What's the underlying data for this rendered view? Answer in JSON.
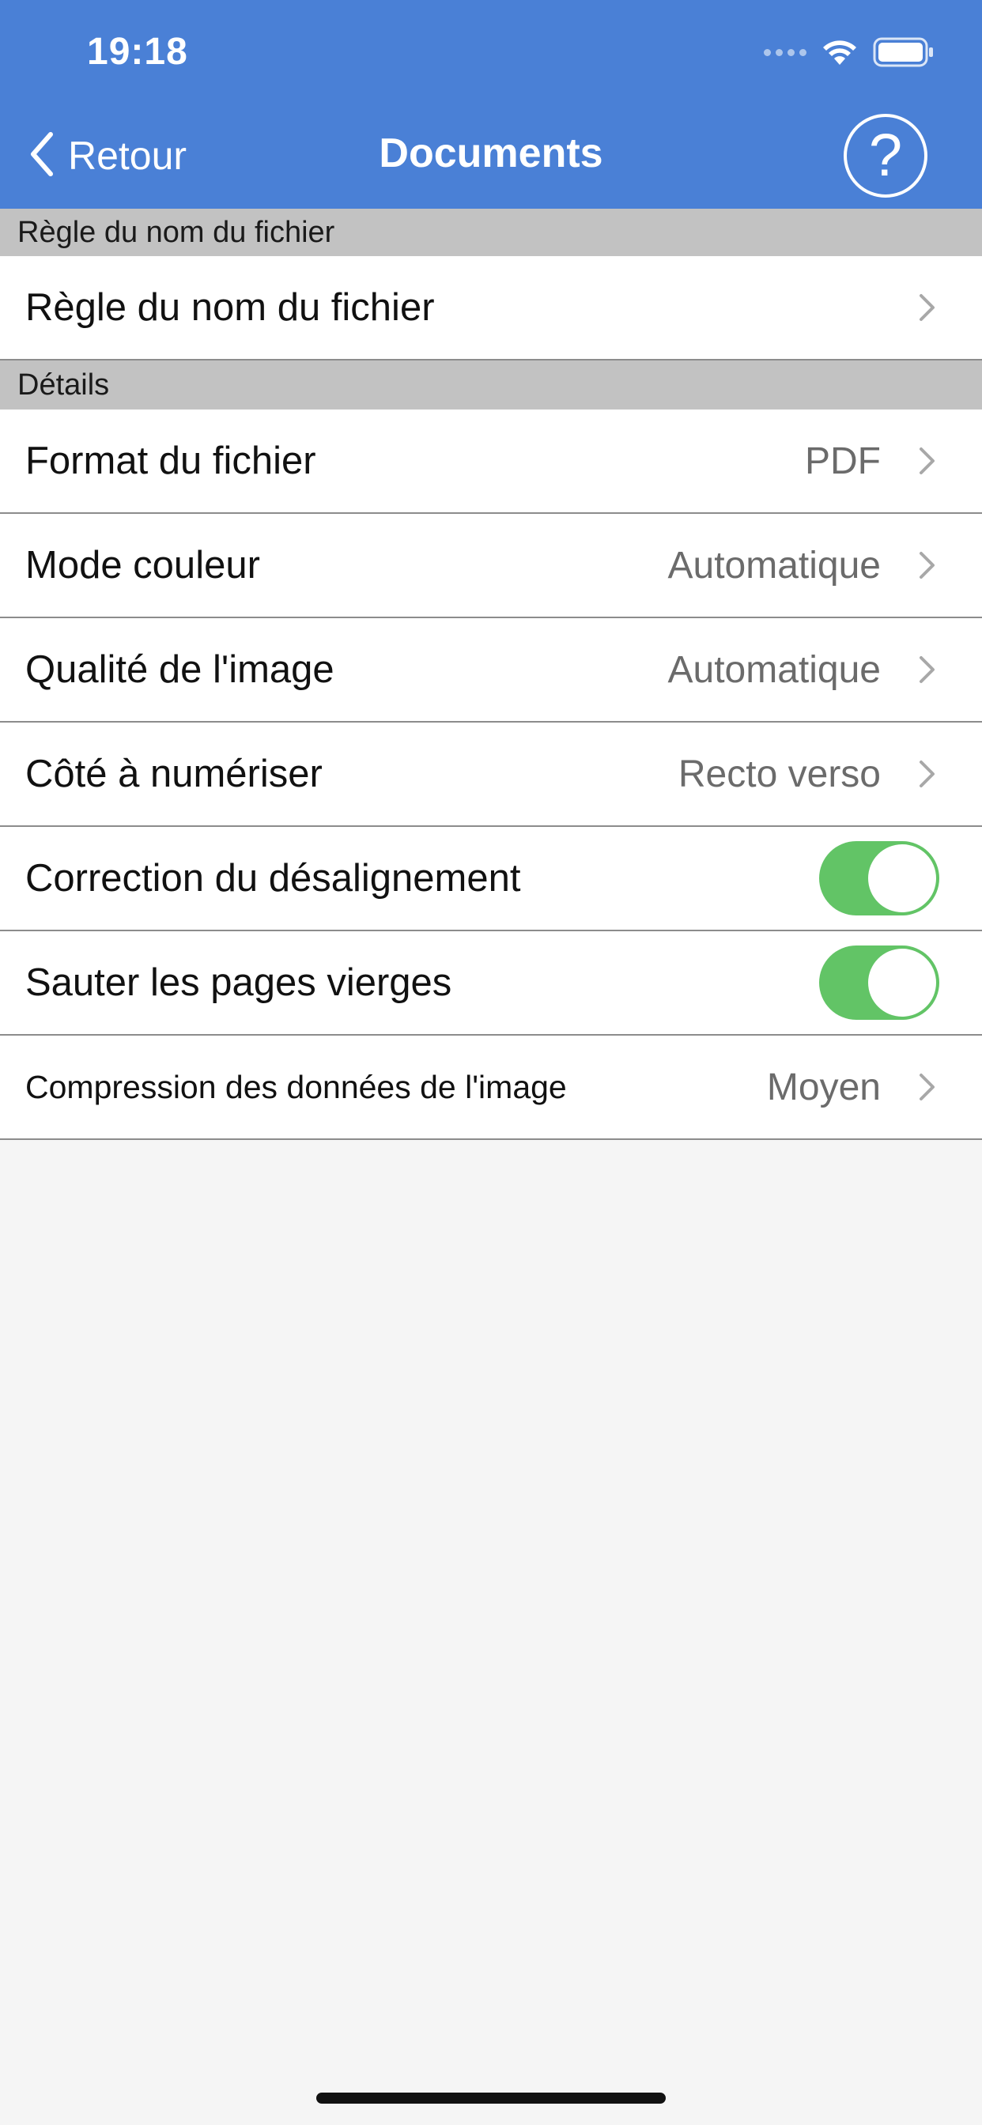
{
  "status_bar": {
    "time": "19:18",
    "icons": [
      "cellular-dots-icon",
      "wifi-icon",
      "battery-icon"
    ]
  },
  "nav": {
    "back_label": "Retour",
    "title": "Documents",
    "help_symbol": "?"
  },
  "sections": [
    {
      "header": "Règle du nom du fichier",
      "rows": [
        {
          "label": "Règle du nom du fichier",
          "value": "",
          "type": "disclosure"
        }
      ]
    },
    {
      "header": "Détails",
      "rows": [
        {
          "label": "Format du fichier",
          "value": "PDF",
          "type": "disclosure"
        },
        {
          "label": "Mode couleur",
          "value": "Automatique",
          "type": "disclosure"
        },
        {
          "label": "Qualité de l'image",
          "value": "Automatique",
          "type": "disclosure"
        },
        {
          "label": "Côté à numériser",
          "value": "Recto verso",
          "type": "disclosure"
        },
        {
          "label": "Correction du désalignement",
          "value": true,
          "type": "toggle"
        },
        {
          "label": "Sauter les pages vierges",
          "value": true,
          "type": "toggle"
        },
        {
          "label": "Compression des données de l'image",
          "value": "Moyen",
          "type": "disclosure"
        }
      ]
    }
  ],
  "colors": {
    "nav_background": "#4a80d6",
    "section_header_background": "#c2c2c2",
    "toggle_on": "#62c466",
    "page_background": "#f5f5f5",
    "value_text": "#6b6b6b"
  }
}
